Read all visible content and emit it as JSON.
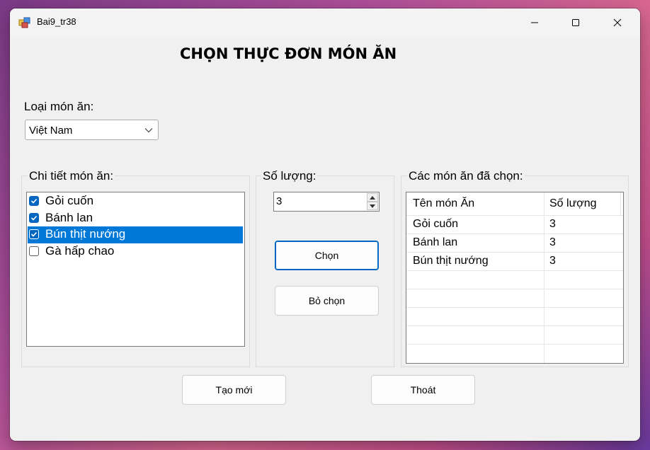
{
  "window": {
    "title": "Bai9_tr38",
    "controls": [
      "minimize-icon",
      "maximize-icon",
      "close-icon"
    ]
  },
  "heading": "CHỌN THỰC ĐƠN MÓN ĂN",
  "category": {
    "label": "Loại món ăn:",
    "selected": "Việt Nam"
  },
  "details": {
    "title": "Chi tiết món ăn:",
    "items": [
      {
        "label": "Gỏi cuốn",
        "checked": true,
        "selected": false
      },
      {
        "label": "Bánh lan",
        "checked": true,
        "selected": false
      },
      {
        "label": "Bún thịt nướng",
        "checked": true,
        "selected": true
      },
      {
        "label": "Gà hấp chao",
        "checked": false,
        "selected": false
      }
    ]
  },
  "quantity": {
    "title": "Số lượng:",
    "value": "3"
  },
  "buttons": {
    "choose": "Chọn",
    "unchoose": "Bỏ chọn",
    "new": "Tạo mới",
    "exit": "Thoát"
  },
  "chosen": {
    "title": "Các món ăn đã chọn:",
    "columns": [
      "Tên món Ăn",
      "Số lượng"
    ],
    "rows": [
      [
        "Gỏi cuốn",
        "3"
      ],
      [
        "Bánh lan",
        "3"
      ],
      [
        "Bún thịt nướng",
        "3"
      ]
    ]
  },
  "colors": {
    "accent": "#0067c0",
    "selection": "#0078d7"
  }
}
